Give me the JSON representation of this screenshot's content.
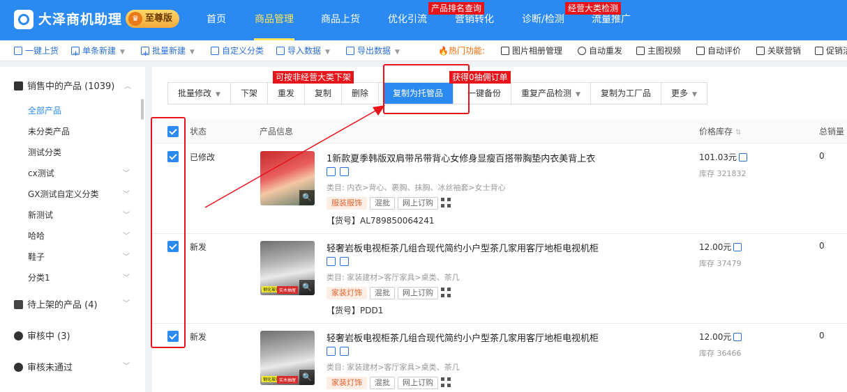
{
  "app": {
    "title": "大泽商机助理",
    "badge": "至尊版"
  },
  "nav": [
    {
      "label": "首页"
    },
    {
      "label": "商品管理"
    },
    {
      "label": "商品上货"
    },
    {
      "label": "优化引流"
    },
    {
      "label": "营销转化"
    },
    {
      "label": "诊断/检测"
    },
    {
      "label": "流量推广"
    }
  ],
  "nav_callouts": {
    "ranking": "产品排名查询",
    "category_check": "经营大类检测"
  },
  "toolbar": {
    "items": [
      "一键上货",
      "单条新建",
      "批量新建",
      "自定义分类",
      "导入数据",
      "导出数据"
    ],
    "hot_label": "热门功能:",
    "hot_items": [
      "图片相册管理",
      "自动重发",
      "主图视频",
      "自动评价",
      "关联营销",
      "促销活"
    ]
  },
  "sidebar": {
    "groups": [
      {
        "label": "销售中的产品 (1039)"
      },
      {
        "label": "待上架的产品 (4)"
      },
      {
        "label": "审核中 (3)"
      },
      {
        "label": "审核未通过"
      }
    ],
    "sub_items": [
      "全部产品",
      "未分类产品",
      "测试分类",
      "cx测试",
      "GX测试自定义分类",
      "新测试",
      "哈哈",
      "鞋子",
      "分类1"
    ]
  },
  "actions": {
    "buttons": [
      "批量修改",
      "下架",
      "重发",
      "复制",
      "删除",
      "复制为托管品",
      "一键备份",
      "重复产品检测",
      "复制为工厂品",
      "更多"
    ],
    "callout_offshelf": "可按非经营大类下架",
    "callout_copy": "获得0抽佣订单"
  },
  "table": {
    "headers": {
      "status": "状态",
      "info": "产品信息",
      "price": "价格库存",
      "sales": "总销量"
    },
    "rows": [
      {
        "status": "已修改",
        "title": "1新款夏季韩版双肩带吊带背心女修身显瘦百搭带胸垫内衣美背上衣",
        "category": "类目: 内衣>背心、裹胸、抹胸、冰丝袖套>女士背心",
        "cat_tag": "服装服饰",
        "tags": [
          "混批",
          "网上订购"
        ],
        "sku": "【货号】AL789850064241",
        "price": "101.03元",
        "stock": "库存 321832",
        "sales": "0"
      },
      {
        "status": "新发",
        "title": "轻奢岩板电视柜茶几组合现代简约小户型茶几家用客厅地柜电视机柜",
        "category": "类目: 家装建材>客厅家具>桌类、茶几",
        "cat_tag": "家装灯饰",
        "tags": [
          "混批",
          "网上订购"
        ],
        "sku": "【货号】PDD1",
        "price": "12.00元",
        "stock": "库存 37479",
        "sales": "0"
      },
      {
        "status": "新发",
        "title": "轻奢岩板电视柜茶几组合现代简约小户型茶几家用客厅地柜电视机柜",
        "category": "类目: 家装建材>客厅家具>桌类、茶几",
        "cat_tag": "家装灯饰",
        "tags": [
          "混批",
          "网上订购"
        ],
        "sku": "",
        "price": "12.00元",
        "stock": "库存 36466",
        "sales": "0"
      }
    ]
  },
  "thumb_labels": [
    "钢化玻璃台面",
    "实木抽屉"
  ],
  "colors": {
    "header_bg": "#2a8af1",
    "accent": "#2a8af1",
    "active_nav": "#ffe45c",
    "callout_red": "#e8141b"
  }
}
